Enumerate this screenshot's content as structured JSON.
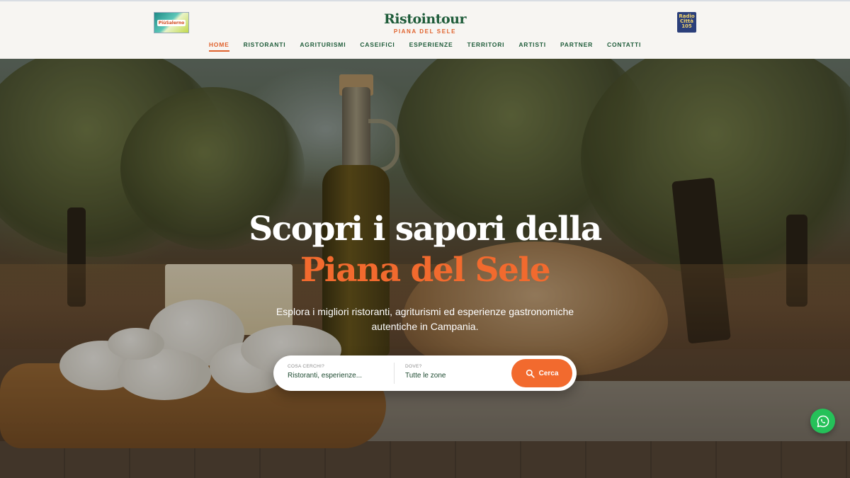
{
  "header": {
    "left_logo_text": "PiùSalerno",
    "brand_title": "Ristointour",
    "brand_subtitle": "PIANA DEL SELE",
    "right_logo_text": "Radio Città 105"
  },
  "nav": {
    "items": [
      {
        "label": "HOME",
        "active": true
      },
      {
        "label": "RISTORANTI",
        "active": false
      },
      {
        "label": "AGRITURISMI",
        "active": false
      },
      {
        "label": "CASEIFICI",
        "active": false
      },
      {
        "label": "ESPERIENZE",
        "active": false
      },
      {
        "label": "TERRITORI",
        "active": false
      },
      {
        "label": "ARTISTI",
        "active": false
      },
      {
        "label": "PARTNER",
        "active": false
      },
      {
        "label": "CONTATTI",
        "active": false
      }
    ]
  },
  "hero": {
    "title_line1": "Scopri i sapori della",
    "title_line2": "Piana del Sele",
    "subtitle": "Esplora i migliori ristoranti, agriturismi ed esperienze gastronomiche autentiche in Campania."
  },
  "search": {
    "what_label": "COSA CERCHI?",
    "what_value": "Ristoranti, esperienze...",
    "where_label": "DOVE?",
    "where_value": "Tutte le zone",
    "button_label": "Cerca",
    "button_icon": "search-icon"
  },
  "floating": {
    "whatsapp_icon": "whatsapp-icon"
  },
  "colors": {
    "brand_green": "#1f5c3a",
    "accent_orange": "#f26a2e",
    "whatsapp_green": "#25c159"
  }
}
